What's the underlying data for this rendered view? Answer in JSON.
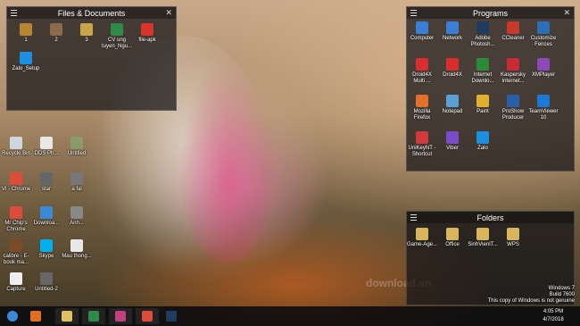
{
  "fences": {
    "files": {
      "title": "Files & Documents",
      "items": [
        {
          "label": "1",
          "icon": "folder-icon",
          "color": "#b8862e"
        },
        {
          "label": "2",
          "icon": "folder-icon",
          "color": "#8a6b4a"
        },
        {
          "label": "3",
          "icon": "folder-icon",
          "color": "#c9a548"
        },
        {
          "label": "CV ung tuyen_Ngu...",
          "icon": "excel-icon",
          "color": "#2f8a4a"
        },
        {
          "label": "file-apk",
          "icon": "pdf-icon",
          "color": "#d9342b"
        },
        {
          "label": "Zalo_Setup",
          "icon": "zalo-icon",
          "color": "#1c8fe0"
        }
      ]
    },
    "programs": {
      "title": "Programs",
      "items": [
        {
          "label": "Computer",
          "icon": "computer-icon",
          "color": "#3a7ed6"
        },
        {
          "label": "Network",
          "icon": "network-icon",
          "color": "#3a7ed6"
        },
        {
          "label": "Adobe Photosh...",
          "icon": "photoshop-icon",
          "color": "#1f3c5e"
        },
        {
          "label": "CCleaner",
          "icon": "ccleaner-icon",
          "color": "#c53a2b"
        },
        {
          "label": "Customize Fences",
          "icon": "fences-icon",
          "color": "#2b6fb8"
        },
        {
          "label": "Droid4X Multi ...",
          "icon": "droid4x-icon",
          "color": "#d92e2e"
        },
        {
          "label": "Droid4X",
          "icon": "droid4x-icon",
          "color": "#d92e2e"
        },
        {
          "label": "Internet Downlo...",
          "icon": "idm-icon",
          "color": "#2d8a3a"
        },
        {
          "label": "Kaspersky Internet...",
          "icon": "kaspersky-icon",
          "color": "#c92a36"
        },
        {
          "label": "XMPlayer",
          "icon": "xmplayer-icon",
          "color": "#8a4ab8"
        },
        {
          "label": "Mozilla Firefox",
          "icon": "firefox-icon",
          "color": "#e0702a"
        },
        {
          "label": "Notepad",
          "icon": "notepad-icon",
          "color": "#5aa0d8"
        },
        {
          "label": "Paint",
          "icon": "paint-icon",
          "color": "#e0b030"
        },
        {
          "label": "ProShow Producer",
          "icon": "proshow-icon",
          "color": "#2a5fa8"
        },
        {
          "label": "TeamViewer 10",
          "icon": "teamviewer-icon",
          "color": "#1c7ad6"
        },
        {
          "label": "UniKeyNT - Shortcut",
          "icon": "unikey-icon",
          "color": "#d13a3a"
        },
        {
          "label": "Viber",
          "icon": "viber-icon",
          "color": "#7a4bc8"
        },
        {
          "label": "Zalo",
          "icon": "zalo-icon",
          "color": "#1c8fe0"
        }
      ]
    },
    "folders": {
      "title": "Folders",
      "items": [
        {
          "label": "Game-Age...",
          "icon": "folder-icon",
          "color": "#d8b45a"
        },
        {
          "label": "Office",
          "icon": "folder-icon",
          "color": "#d8b45a"
        },
        {
          "label": "SinhVienIT...",
          "icon": "folder-icon",
          "color": "#d8b45a"
        },
        {
          "label": "WPS",
          "icon": "folder-icon",
          "color": "#d8b45a"
        }
      ]
    }
  },
  "desktop": [
    {
      "label": "Recycle Bin",
      "icon": "recycle-bin-icon",
      "color": "#cfd6de"
    },
    {
      "label": "DDS Ph...",
      "icon": "document-icon",
      "color": "#e8e8e8"
    },
    {
      "label": "Untitled",
      "icon": "image-icon",
      "color": "#8a9a6a"
    },
    {
      "label": "VI - Chrome",
      "icon": "chrome-icon",
      "color": "#dd4b39"
    },
    {
      "label": "star",
      "icon": "image-icon",
      "color": "#666"
    },
    {
      "label": "a fal",
      "icon": "image-icon",
      "color": "#777"
    },
    {
      "label": "Mr Chip's Chrome",
      "icon": "chrome-icon",
      "color": "#dd4b39"
    },
    {
      "label": "Downloa...",
      "icon": "download-icon",
      "color": "#3a8ad8"
    },
    {
      "label": "Anh...",
      "icon": "image-icon",
      "color": "#888"
    },
    {
      "label": "calibre - E-book ma...",
      "icon": "calibre-icon",
      "color": "#7a4a2a"
    },
    {
      "label": "Skype",
      "icon": "skype-icon",
      "color": "#00aff0"
    },
    {
      "label": "Mau thong...",
      "icon": "document-icon",
      "color": "#e8e8e8"
    },
    {
      "label": "Capture",
      "icon": "image-icon",
      "color": "#eee"
    },
    {
      "label": "Untitled-2",
      "icon": "image-icon",
      "color": "#666"
    }
  ],
  "taskbar": {
    "items": [
      {
        "name": "start-button",
        "icon": "windows-icon",
        "color": "#3a8ad8"
      },
      {
        "name": "media-player-button",
        "icon": "media-player-icon",
        "color": "#e07020"
      },
      {
        "name": "explorer-button",
        "icon": "folder-icon",
        "color": "#e0c060"
      },
      {
        "name": "excel-button",
        "icon": "excel-icon",
        "color": "#2f8a4a"
      },
      {
        "name": "paint-button",
        "icon": "paint-icon",
        "color": "#c04080"
      },
      {
        "name": "chrome-button",
        "icon": "chrome-icon",
        "color": "#dd4b39"
      },
      {
        "name": "photoshop-button",
        "icon": "photoshop-icon",
        "color": "#1f3c5e"
      }
    ],
    "time": "4:05 PM",
    "date": "4/7/2018"
  },
  "os_watermark": {
    "line1": "Windows 7",
    "line2": "Build 7600",
    "line3": "This copy of Windows is not genuine"
  }
}
